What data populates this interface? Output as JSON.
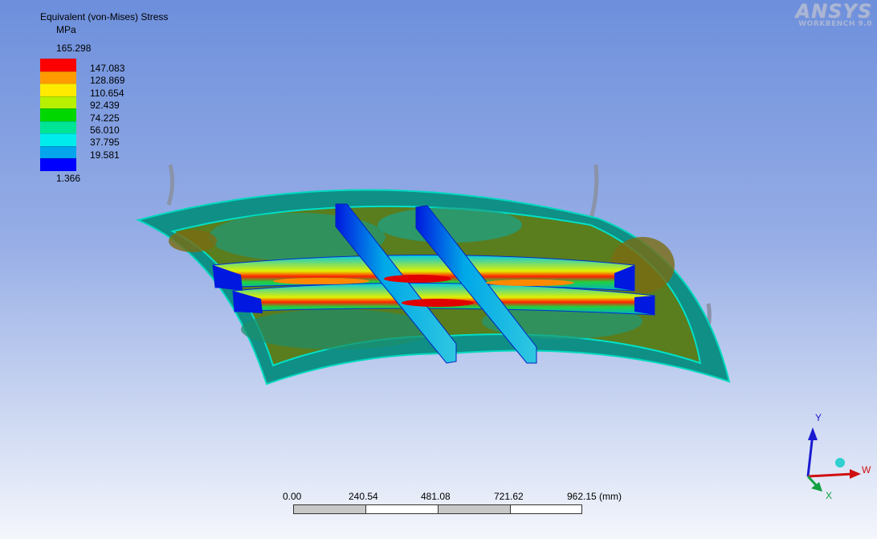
{
  "legend": {
    "title": "Equivalent (von-Mises) Stress",
    "unit": "MPa",
    "max": "165.298",
    "min": "1.366",
    "levels": [
      "147.083",
      "128.869",
      "110.654",
      "92.439",
      "74.225",
      "56.010",
      "37.795",
      "19.581"
    ],
    "colors": [
      "#ff0000",
      "#ff9a00",
      "#ffea00",
      "#b7f000",
      "#00d700",
      "#00e496",
      "#00ecec",
      "#00a5ec",
      "#0000ff"
    ]
  },
  "brand": {
    "name": "ANSYS",
    "subtitle": "WORKBENCH 9.0"
  },
  "scale_bar": {
    "labels": [
      "0.00",
      "240.54",
      "481.08",
      "721.62",
      "962.15 (mm)"
    ]
  },
  "triad": {
    "y": "Y",
    "w": "W",
    "x": "X"
  }
}
